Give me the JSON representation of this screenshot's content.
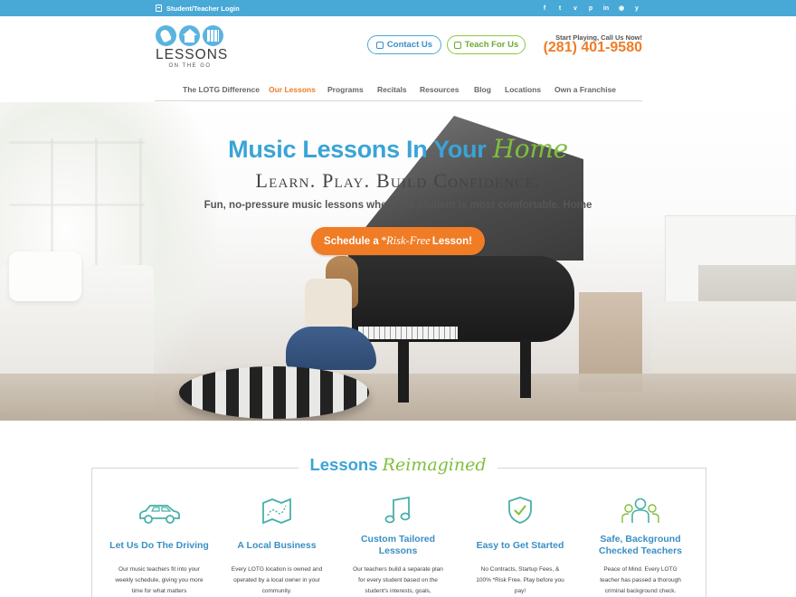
{
  "topbar": {
    "login_label": "Student/Teacher Login",
    "social_icons": [
      "facebook-icon",
      "twitter-icon",
      "vimeo-icon",
      "pinterest-icon",
      "linkedin-icon",
      "instagram-icon",
      "yelp-icon"
    ],
    "social_glyphs": [
      "f",
      "t",
      "v",
      "p",
      "in",
      "◉",
      "y"
    ],
    "bg_color": "#48a8d6"
  },
  "header": {
    "logo_text": "LESSONS",
    "logo_subtext": "ON THE GO",
    "contact_label": "Contact Us",
    "teach_label": "Teach For Us",
    "call_label": "Start Playing, Call Us Now!",
    "phone": "(281) 401-9580"
  },
  "nav": {
    "items": [
      {
        "label": "The LOTG Difference"
      },
      {
        "label": "Our Lessons"
      },
      {
        "label": "Programs"
      },
      {
        "label": "Recitals"
      },
      {
        "label": "Resources"
      },
      {
        "label": "Blog"
      },
      {
        "label": "Locations"
      },
      {
        "label": "Own a Franchise"
      }
    ],
    "active": "Our Lessons"
  },
  "hero": {
    "title_main": "Music Lessons In Your ",
    "title_accent": "Home",
    "subtitle": "Learn. Play. Build Confidence.",
    "description": "Fun, no-pressure music lessons where the student is most comfortable. Home",
    "cta_prefix": "Schedule a ",
    "cta_accent": "*Risk-Free",
    "cta_suffix": " Lesson!"
  },
  "lessons": {
    "title_main": "Lessons ",
    "title_accent": "Reimagined",
    "features": [
      {
        "icon": "car-icon",
        "title": "Let Us Do The Driving",
        "desc": "Our music teachers fit into your weekly schedule, giving you more time for what matters"
      },
      {
        "icon": "map-icon",
        "title": "A Local Business",
        "desc": "Every LOTG location is owned and operated by a local owner in your community."
      },
      {
        "icon": "music-note-icon",
        "title": "Custom Tailored Lessons",
        "desc": "Our teachers build a separate plan for every student based on the student's interests, goals,"
      },
      {
        "icon": "shield-check-icon",
        "title": "Easy to Get Started",
        "desc": "No Contracts, Startup Fees, & 100% *Risk Free. Play before you pay!"
      },
      {
        "icon": "people-icon",
        "title": "Safe, Background Checked Teachers",
        "desc": "Peace of Mind. Every LOTG teacher has passed a thorough criminal background check."
      }
    ]
  },
  "colors": {
    "brand_blue": "#3aa4d6",
    "brand_green": "#7fbf3d",
    "brand_orange": "#f07c26"
  }
}
